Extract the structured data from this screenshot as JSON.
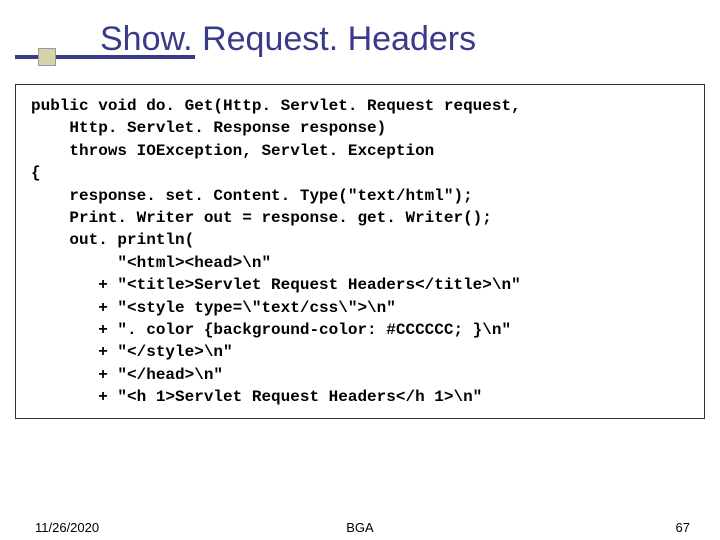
{
  "title": "Show. Request. Headers",
  "code_lines": [
    "public void do. Get(Http. Servlet. Request request,",
    "    Http. Servlet. Response response)",
    "    throws IOException, Servlet. Exception",
    "{",
    "    response. set. Content. Type(\"text/html\");",
    "    Print. Writer out = response. get. Writer();",
    "    out. println(",
    "         \"<html><head>\\n\"",
    "       + \"<title>Servlet Request Headers</title>\\n\"",
    "       + \"<style type=\\\"text/css\\\">\\n\"",
    "       + \". color {background-color: #CCCCCC; }\\n\"",
    "       + \"</style>\\n\"",
    "       + \"</head>\\n\"",
    "       + \"<h 1>Servlet Request Headers</h 1>\\n\""
  ],
  "footer": {
    "date": "11/26/2020",
    "center": "BGA",
    "page": "67"
  }
}
